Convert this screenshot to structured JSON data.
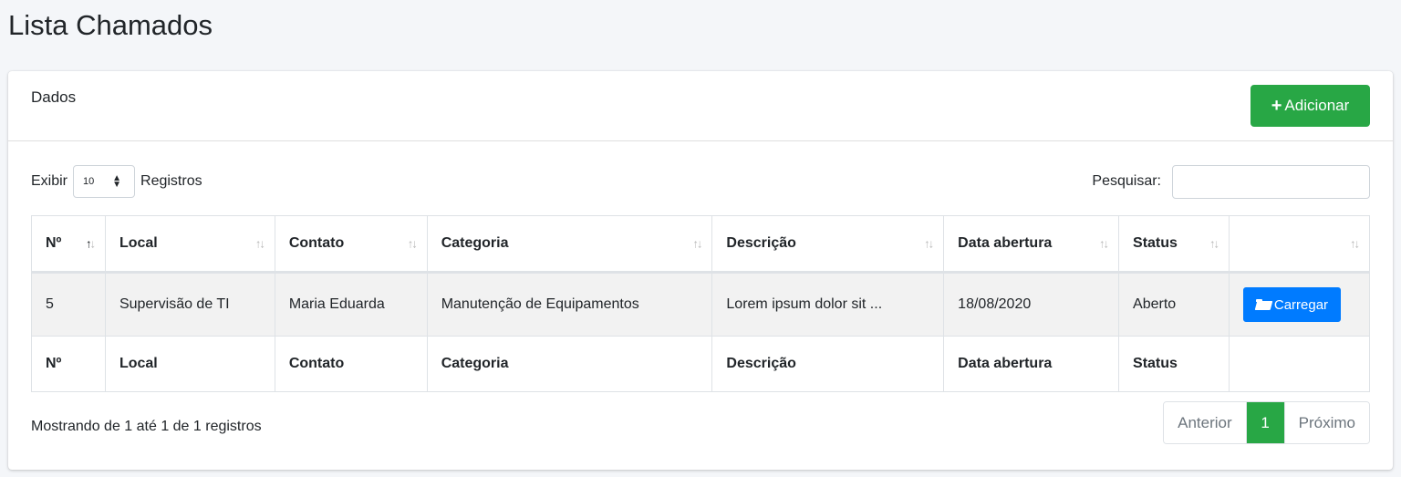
{
  "page": {
    "title": "Lista Chamados"
  },
  "card": {
    "title": "Dados",
    "add_label": "Adicionar"
  },
  "length": {
    "prefix": "Exibir",
    "value": "10",
    "suffix": "Registros"
  },
  "search": {
    "label": "Pesquisar:",
    "value": ""
  },
  "table": {
    "headers": [
      "Nº",
      "Local",
      "Contato",
      "Categoria",
      "Descrição",
      "Data abertura",
      "Status",
      ""
    ],
    "rows": [
      {
        "numero": "5",
        "local": "Supervisão de TI",
        "contato": "Maria Eduarda",
        "categoria": "Manutenção de Equipamentos",
        "descricao": "Lorem ipsum dolor sit ...",
        "data_abertura": "18/08/2020",
        "status": "Aberto",
        "action_label": "Carregar"
      }
    ],
    "footers": [
      "Nº",
      "Local",
      "Contato",
      "Categoria",
      "Descrição",
      "Data abertura",
      "Status",
      ""
    ]
  },
  "info": "Mostrando de 1 até 1 de 1 registros",
  "pagination": {
    "previous": "Anterior",
    "current": "1",
    "next": "Próximo"
  },
  "colors": {
    "success": "#28a745",
    "primary": "#007bff",
    "background": "#f4f6f9"
  }
}
